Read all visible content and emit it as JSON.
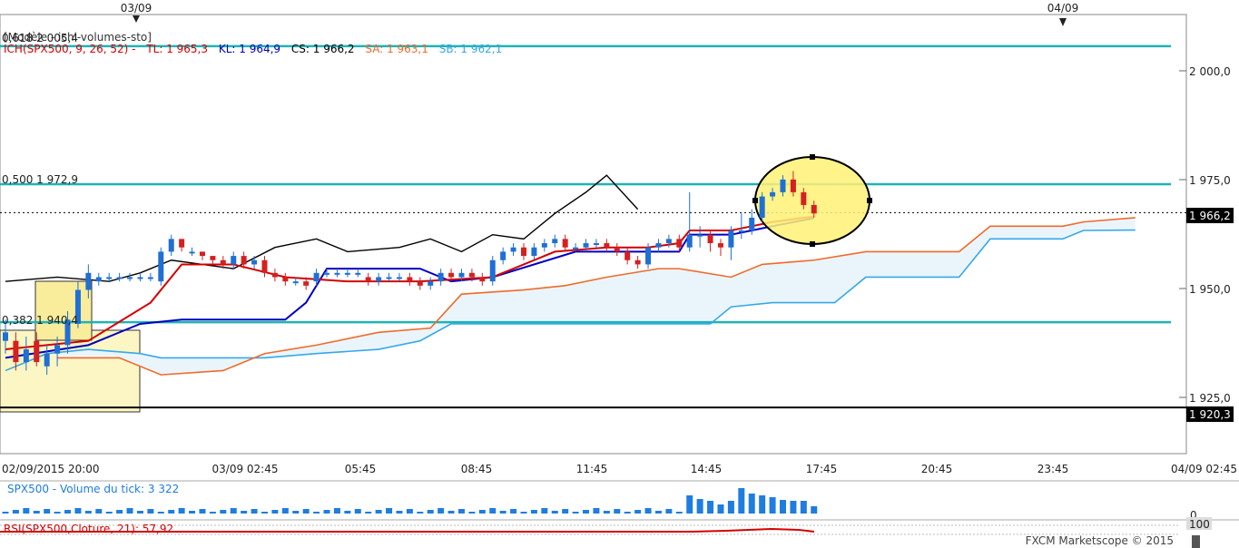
{
  "top_dates": [
    "03/09",
    "04/09"
  ],
  "legend": {
    "model": "[Modèle - ichi-volumes-sto]",
    "ichimoku": "ICH(SPX500, 9, 26, 52) -",
    "tl": "TL: 1 965,3",
    "kl": "KL: 1 964,9",
    "cs": "CS: 1 966,2",
    "sa": "SA: 1 963,1",
    "sb": "SB: 1 962,1"
  },
  "fib_labels": {
    "f618": "0,618 2 005,4",
    "f500": "0,500 1 972,9",
    "f382": "0,382 1 940,4"
  },
  "price_ticks": [
    "2 000,0",
    "1 975,0",
    "1 950,0",
    "1 925,0"
  ],
  "current_price_label": "1 966,2",
  "low_level_label": "1 920,3",
  "time_labels": [
    "02/09/2015 20:00",
    "03/09 02:45",
    "05:45",
    "08:45",
    "11:45",
    "14:45",
    "17:45",
    "20:45",
    "23:45",
    "04/09 02:45"
  ],
  "volume_title": "SPX500 - Volume du tick: 3 322",
  "volume_zero": "0",
  "rsi_title": "RSI(SPX500,Cloture, 21): 57,92",
  "rsi_max": "100",
  "copyright": "FXCM Marketscope © 2015",
  "colors": {
    "fib": "#1fb3b5",
    "tenkan": "#d40000",
    "kijun": "#0000c0",
    "chikou": "#000000",
    "senkou_a": "#f06a2a",
    "senkou_b": "#36a8e8",
    "cloud": "#eaf5fb",
    "bull": "#1f6fd4",
    "bear": "#d42020",
    "highlight": "#fff176",
    "volume": "#1f7de0",
    "price_tag": "#000000"
  },
  "chart_data": {
    "type": "candlestick",
    "price_range": [
      1912,
      2012
    ],
    "levels": {
      "fib_618": 2005.4,
      "fib_500": 1972.9,
      "fib_382": 1940.4,
      "last": 1966.2,
      "low": 1920.3
    },
    "candles": [
      [
        1936,
        1938,
        1933,
        1941
      ],
      [
        1936,
        1931,
        1929,
        1938
      ],
      [
        1931,
        1934,
        1929,
        1937
      ],
      [
        1936,
        1931,
        1930,
        1938
      ],
      [
        1930,
        1933,
        1928,
        1935
      ],
      [
        1933,
        1935,
        1930,
        1937
      ],
      [
        1935,
        1941,
        1933,
        1943
      ],
      [
        1940,
        1948,
        1939,
        1950
      ],
      [
        1948,
        1952,
        1946,
        1954
      ],
      [
        1950,
        1951,
        1949,
        1952
      ],
      [
        1951,
        1951,
        1950,
        1952
      ],
      [
        1951,
        1951,
        1950,
        1952
      ],
      [
        1951,
        1951,
        1950,
        1952
      ],
      [
        1951,
        1951,
        1950,
        1952
      ],
      [
        1951,
        1951,
        1950,
        1952
      ],
      [
        1950,
        1957,
        1949,
        1958
      ],
      [
        1957,
        1960,
        1956,
        1961
      ],
      [
        1960,
        1958,
        1957,
        1960
      ],
      [
        1957,
        1957,
        1956,
        1958
      ],
      [
        1957,
        1956,
        1955,
        1957
      ],
      [
        1956,
        1955,
        1954,
        1956
      ],
      [
        1955,
        1954,
        1953,
        1956
      ],
      [
        1954,
        1956,
        1953,
        1957
      ],
      [
        1956,
        1954,
        1953,
        1957
      ],
      [
        1954,
        1955,
        1953,
        1956
      ],
      [
        1955,
        1952,
        1951,
        1956
      ],
      [
        1952,
        1951,
        1950,
        1953
      ],
      [
        1951,
        1950,
        1949,
        1952
      ],
      [
        1950,
        1950,
        1949,
        1951
      ],
      [
        1950,
        1949,
        1948,
        1951
      ],
      [
        1950,
        1952,
        1949,
        1953
      ],
      [
        1952,
        1952,
        1951,
        1953
      ],
      [
        1952,
        1952,
        1951,
        1953
      ],
      [
        1952,
        1952,
        1951,
        1953
      ],
      [
        1952,
        1952,
        1951,
        1953
      ],
      [
        1951,
        1950,
        1949,
        1952
      ],
      [
        1950,
        1951,
        1949,
        1952
      ],
      [
        1951,
        1951,
        1950,
        1952
      ],
      [
        1951,
        1951,
        1950,
        1952
      ],
      [
        1951,
        1950,
        1949,
        1952
      ],
      [
        1950,
        1949,
        1948,
        1951
      ],
      [
        1949,
        1950,
        1948,
        1951
      ],
      [
        1950,
        1952,
        1949,
        1953
      ],
      [
        1952,
        1951,
        1950,
        1953
      ],
      [
        1951,
        1952,
        1950,
        1953
      ],
      [
        1952,
        1951,
        1950,
        1953
      ],
      [
        1951,
        1950,
        1949,
        1952
      ],
      [
        1950,
        1955,
        1949,
        1956
      ],
      [
        1955,
        1957,
        1954,
        1958
      ],
      [
        1957,
        1958,
        1956,
        1959
      ],
      [
        1958,
        1956,
        1955,
        1959
      ],
      [
        1956,
        1958,
        1955,
        1959
      ],
      [
        1958,
        1959,
        1957,
        1960
      ],
      [
        1959,
        1960,
        1958,
        1961
      ],
      [
        1960,
        1958,
        1957,
        1961
      ],
      [
        1958,
        1958,
        1957,
        1959
      ],
      [
        1958,
        1959,
        1957,
        1960
      ],
      [
        1959,
        1959,
        1958,
        1960
      ],
      [
        1959,
        1958,
        1957,
        1960
      ],
      [
        1958,
        1957,
        1956,
        1959
      ],
      [
        1957,
        1955,
        1954,
        1958
      ],
      [
        1955,
        1954,
        1953,
        1956
      ],
      [
        1954,
        1958,
        1953,
        1959
      ],
      [
        1958,
        1959,
        1957,
        1960
      ],
      [
        1959,
        1960,
        1958,
        1961
      ],
      [
        1960,
        1958,
        1957,
        1961
      ],
      [
        1958,
        1961,
        1957,
        1971
      ],
      [
        1961,
        1961,
        1958,
        1963
      ],
      [
        1961,
        1959,
        1957,
        1962
      ],
      [
        1959,
        1958,
        1956,
        1960
      ],
      [
        1958,
        1962,
        1955,
        1963
      ],
      [
        1962,
        1962,
        1960,
        1966
      ],
      [
        1962,
        1965,
        1961,
        1967
      ],
      [
        1965,
        1970,
        1964,
        1971
      ],
      [
        1970,
        1971,
        1969,
        1972
      ],
      [
        1971,
        1974,
        1970,
        1975
      ],
      [
        1974,
        1971,
        1970,
        1976
      ],
      [
        1971,
        1968,
        1967,
        1972
      ],
      [
        1968,
        1966,
        1965,
        1969
      ]
    ],
    "tenkan": [
      [
        0,
        1934
      ],
      [
        8,
        1936
      ],
      [
        14,
        1945
      ],
      [
        17,
        1954
      ],
      [
        22,
        1954
      ],
      [
        27,
        1951
      ],
      [
        33,
        1950
      ],
      [
        40,
        1950
      ],
      [
        47,
        1951
      ],
      [
        50,
        1954
      ],
      [
        53,
        1957
      ],
      [
        58,
        1958
      ],
      [
        62,
        1958
      ],
      [
        65,
        1959
      ],
      [
        66,
        1962
      ],
      [
        70,
        1962
      ],
      [
        72,
        1963
      ],
      [
        74,
        1964
      ],
      [
        78,
        1965.3
      ]
    ],
    "kijun": [
      [
        0,
        1932
      ],
      [
        8,
        1935
      ],
      [
        13,
        1940
      ],
      [
        17,
        1941
      ],
      [
        27,
        1941
      ],
      [
        29,
        1945
      ],
      [
        31,
        1953
      ],
      [
        40,
        1953
      ],
      [
        43,
        1950
      ],
      [
        47,
        1951
      ],
      [
        55,
        1957
      ],
      [
        58,
        1957
      ],
      [
        62,
        1957
      ],
      [
        65,
        1957
      ],
      [
        66,
        1961
      ],
      [
        70,
        1961
      ],
      [
        72,
        1962
      ],
      [
        74,
        1963
      ],
      [
        78,
        1964.9
      ]
    ],
    "chikou": [
      [
        0,
        1950
      ],
      [
        5,
        1951
      ],
      [
        10,
        1950
      ],
      [
        13,
        1952
      ],
      [
        16,
        1955
      ],
      [
        22,
        1953
      ],
      [
        26,
        1958
      ],
      [
        30,
        1960
      ],
      [
        33,
        1957
      ],
      [
        38,
        1958
      ],
      [
        41,
        1960
      ],
      [
        44,
        1957
      ],
      [
        47,
        1961
      ],
      [
        50,
        1960
      ],
      [
        53,
        1966
      ],
      [
        56,
        1971
      ],
      [
        58,
        1975
      ],
      [
        61,
        1967
      ]
    ],
    "senkou_a": [
      [
        5,
        1932
      ],
      [
        11,
        1932
      ],
      [
        15,
        1928
      ],
      [
        21,
        1929
      ],
      [
        25,
        1933
      ],
      [
        30,
        1935
      ],
      [
        36,
        1938
      ],
      [
        41,
        1939
      ],
      [
        44,
        1947
      ],
      [
        50,
        1948
      ],
      [
        54,
        1949
      ],
      [
        58,
        1951
      ],
      [
        63,
        1953
      ],
      [
        65,
        1953
      ],
      [
        70,
        1951
      ],
      [
        73,
        1954
      ],
      [
        78,
        1955
      ],
      [
        83,
        1957
      ],
      [
        92,
        1957
      ],
      [
        95,
        1963
      ],
      [
        102,
        1963
      ],
      [
        104,
        1964
      ],
      [
        109,
        1965
      ]
    ],
    "senkou_b": [
      [
        0,
        1929
      ],
      [
        4,
        1933
      ],
      [
        8,
        1934
      ],
      [
        13,
        1933
      ],
      [
        15,
        1932
      ],
      [
        22,
        1932
      ],
      [
        25,
        1932
      ],
      [
        30,
        1933
      ],
      [
        36,
        1934
      ],
      [
        40,
        1936
      ],
      [
        43,
        1940
      ],
      [
        50,
        1940
      ],
      [
        55,
        1940
      ],
      [
        68,
        1940
      ],
      [
        70,
        1944
      ],
      [
        74,
        1945
      ],
      [
        80,
        1945
      ],
      [
        83,
        1951
      ],
      [
        92,
        1951
      ],
      [
        95,
        1960
      ],
      [
        102,
        1960
      ],
      [
        104,
        1962
      ],
      [
        109,
        1962.1
      ]
    ],
    "volume": [
      0,
      0,
      0,
      0,
      0,
      0,
      0,
      0,
      0,
      0,
      0,
      0,
      0,
      0,
      0,
      0,
      0,
      0,
      0,
      0,
      0,
      0,
      0,
      0,
      0,
      0,
      0,
      0,
      0,
      0,
      0,
      0,
      0,
      0,
      0,
      0,
      0,
      0,
      0,
      0,
      0,
      0,
      0,
      0,
      0,
      0,
      0,
      0,
      0,
      0,
      0,
      0,
      0,
      0,
      0,
      0,
      0,
      0,
      0,
      0,
      0,
      0,
      0,
      0,
      0,
      0,
      0,
      0,
      0,
      0,
      0,
      0,
      0,
      0,
      0,
      0,
      0,
      0,
      0
    ],
    "rsi": [
      [
        0,
        50
      ],
      [
        30,
        52
      ],
      [
        60,
        53
      ],
      [
        75,
        57.92
      ],
      [
        78,
        57.92
      ]
    ]
  }
}
